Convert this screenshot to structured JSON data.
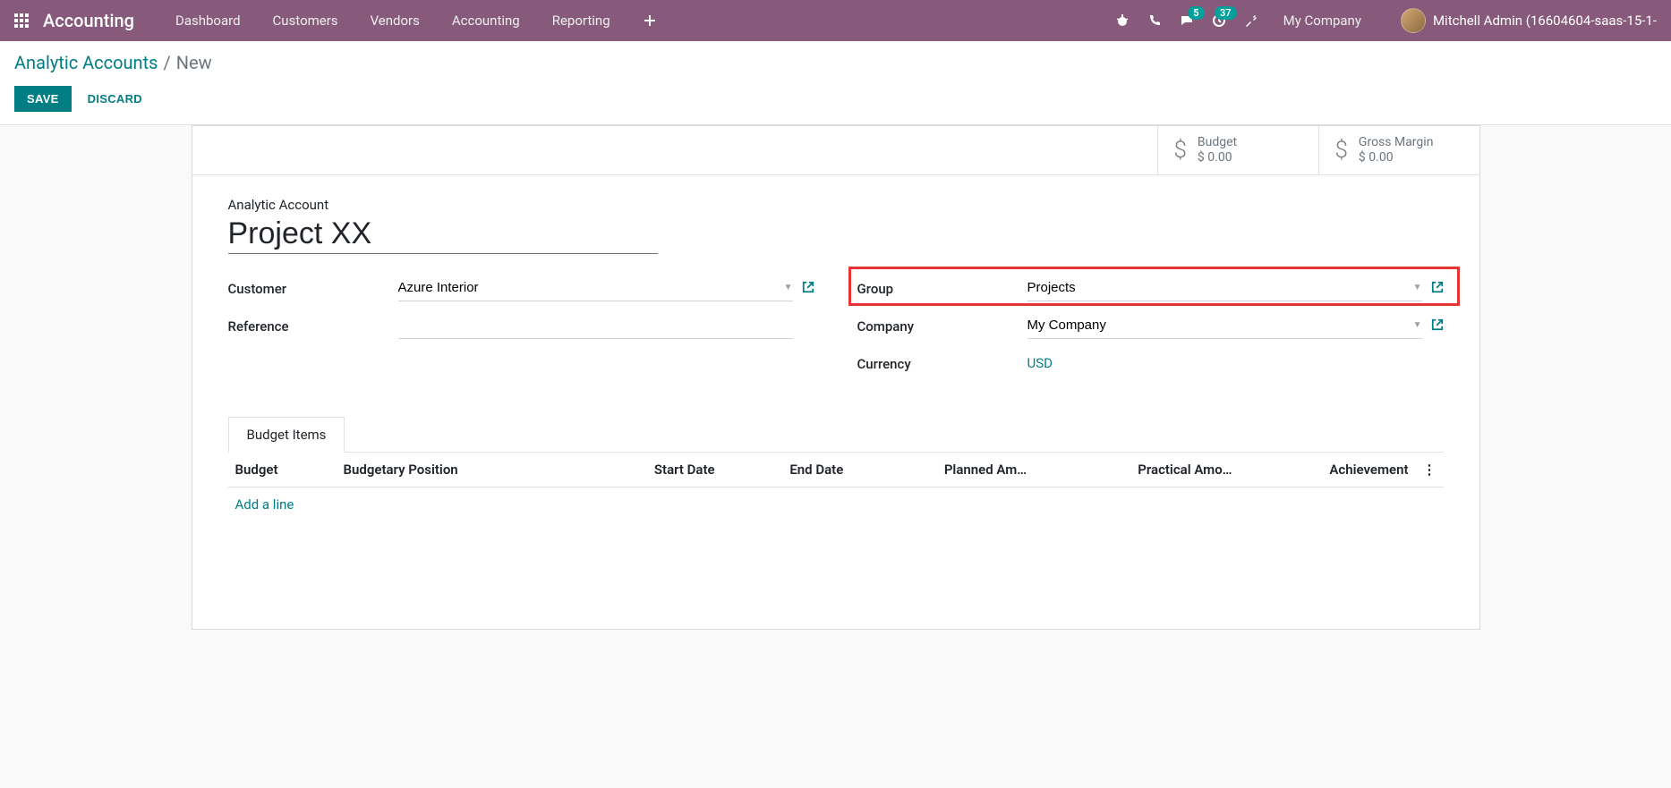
{
  "navbar": {
    "brand": "Accounting",
    "menu": [
      "Dashboard",
      "Customers",
      "Vendors",
      "Accounting",
      "Reporting"
    ],
    "messages_badge": "5",
    "activities_badge": "37",
    "company": "My Company",
    "user": "Mitchell Admin (16604604-saas-15-1-"
  },
  "control_panel": {
    "breadcrumb_root": "Analytic Accounts",
    "breadcrumb_current": "New",
    "save": "SAVE",
    "discard": "DISCARD"
  },
  "stat_buttons": {
    "budget": {
      "label": "Budget",
      "value": "$ 0.00"
    },
    "margin": {
      "label": "Gross Margin",
      "value": "$ 0.00"
    }
  },
  "form": {
    "title_label": "Analytic Account",
    "title_value": "Project XX",
    "left": {
      "customer_label": "Customer",
      "customer_value": "Azure Interior",
      "reference_label": "Reference",
      "reference_value": ""
    },
    "right": {
      "group_label": "Group",
      "group_value": "Projects",
      "company_label": "Company",
      "company_value": "My Company",
      "currency_label": "Currency",
      "currency_value": "USD"
    }
  },
  "tabs": {
    "budget_items": "Budget Items"
  },
  "table": {
    "headers": {
      "budget": "Budget",
      "position": "Budgetary Position",
      "start": "Start Date",
      "end": "End Date",
      "planned": "Planned Am…",
      "practical": "Practical Amo…",
      "achievement": "Achievement"
    },
    "add_line": "Add a line"
  }
}
